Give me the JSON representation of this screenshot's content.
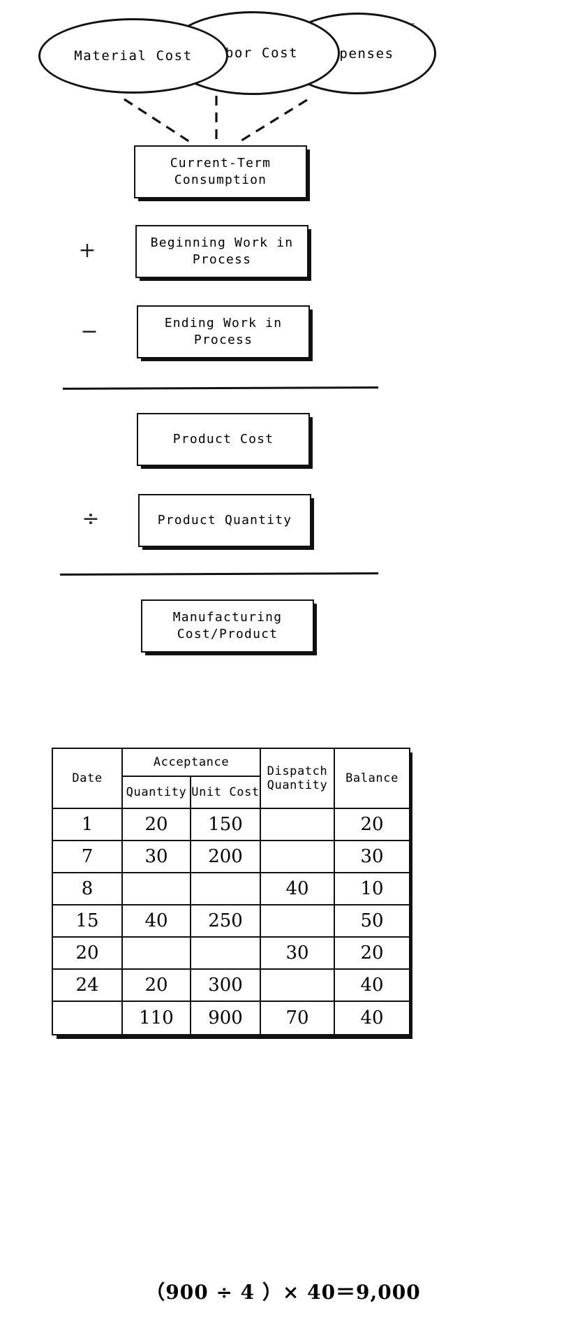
{
  "flow": {
    "inputs": [
      {
        "id": "material-cost",
        "label": "Material Cost"
      },
      {
        "id": "labor-cost",
        "label": "Labor Cost"
      },
      {
        "id": "expenses",
        "label": "Expenses"
      }
    ],
    "boxes": [
      {
        "id": "current-term-consumption",
        "line1": "Current-Term",
        "line2": "Consumption"
      },
      {
        "id": "beginning-wip",
        "line1": "Beginning Work in",
        "line2": "Process"
      },
      {
        "id": "ending-wip",
        "line1": "Ending Work in Process",
        "line2": ""
      },
      {
        "id": "product-cost",
        "line1": "Product Cost",
        "line2": ""
      },
      {
        "id": "product-quantity",
        "line1": "Product Quantity",
        "line2": ""
      },
      {
        "id": "manufacturing-cost",
        "line1": "Manufacturing",
        "line2": "Cost/Product"
      }
    ],
    "operators": {
      "plus": "+",
      "minus": "−",
      "divide": "÷"
    }
  },
  "ledger": {
    "headers": {
      "date": "Date",
      "acceptance": "Acceptance",
      "quantity": "Quantity",
      "unit_cost": "Unit Cost",
      "dispatch_quantity_l1": "Dispatch",
      "dispatch_quantity_l2": "Quantity",
      "balance": "Balance"
    },
    "rows": [
      {
        "date": "1",
        "quantity": "20",
        "unit_cost": "150",
        "dispatch": "",
        "balance": "20"
      },
      {
        "date": "7",
        "quantity": "30",
        "unit_cost": "200",
        "dispatch": "",
        "balance": "30"
      },
      {
        "date": "8",
        "quantity": "",
        "unit_cost": "",
        "dispatch": "40",
        "balance": "10"
      },
      {
        "date": "15",
        "quantity": "40",
        "unit_cost": "250",
        "dispatch": "",
        "balance": "50"
      },
      {
        "date": "20",
        "quantity": "",
        "unit_cost": "",
        "dispatch": "30",
        "balance": "20"
      },
      {
        "date": "24",
        "quantity": "20",
        "unit_cost": "300",
        "dispatch": "",
        "balance": "40"
      }
    ],
    "total": {
      "date": "",
      "quantity": "110",
      "unit_cost": "900",
      "dispatch": "70",
      "balance": "40"
    }
  },
  "formula": {
    "text": "（900 ÷ 4 ）× 40＝9,000"
  },
  "colors": {
    "ink": "#111111",
    "paper": "#ffffff"
  }
}
